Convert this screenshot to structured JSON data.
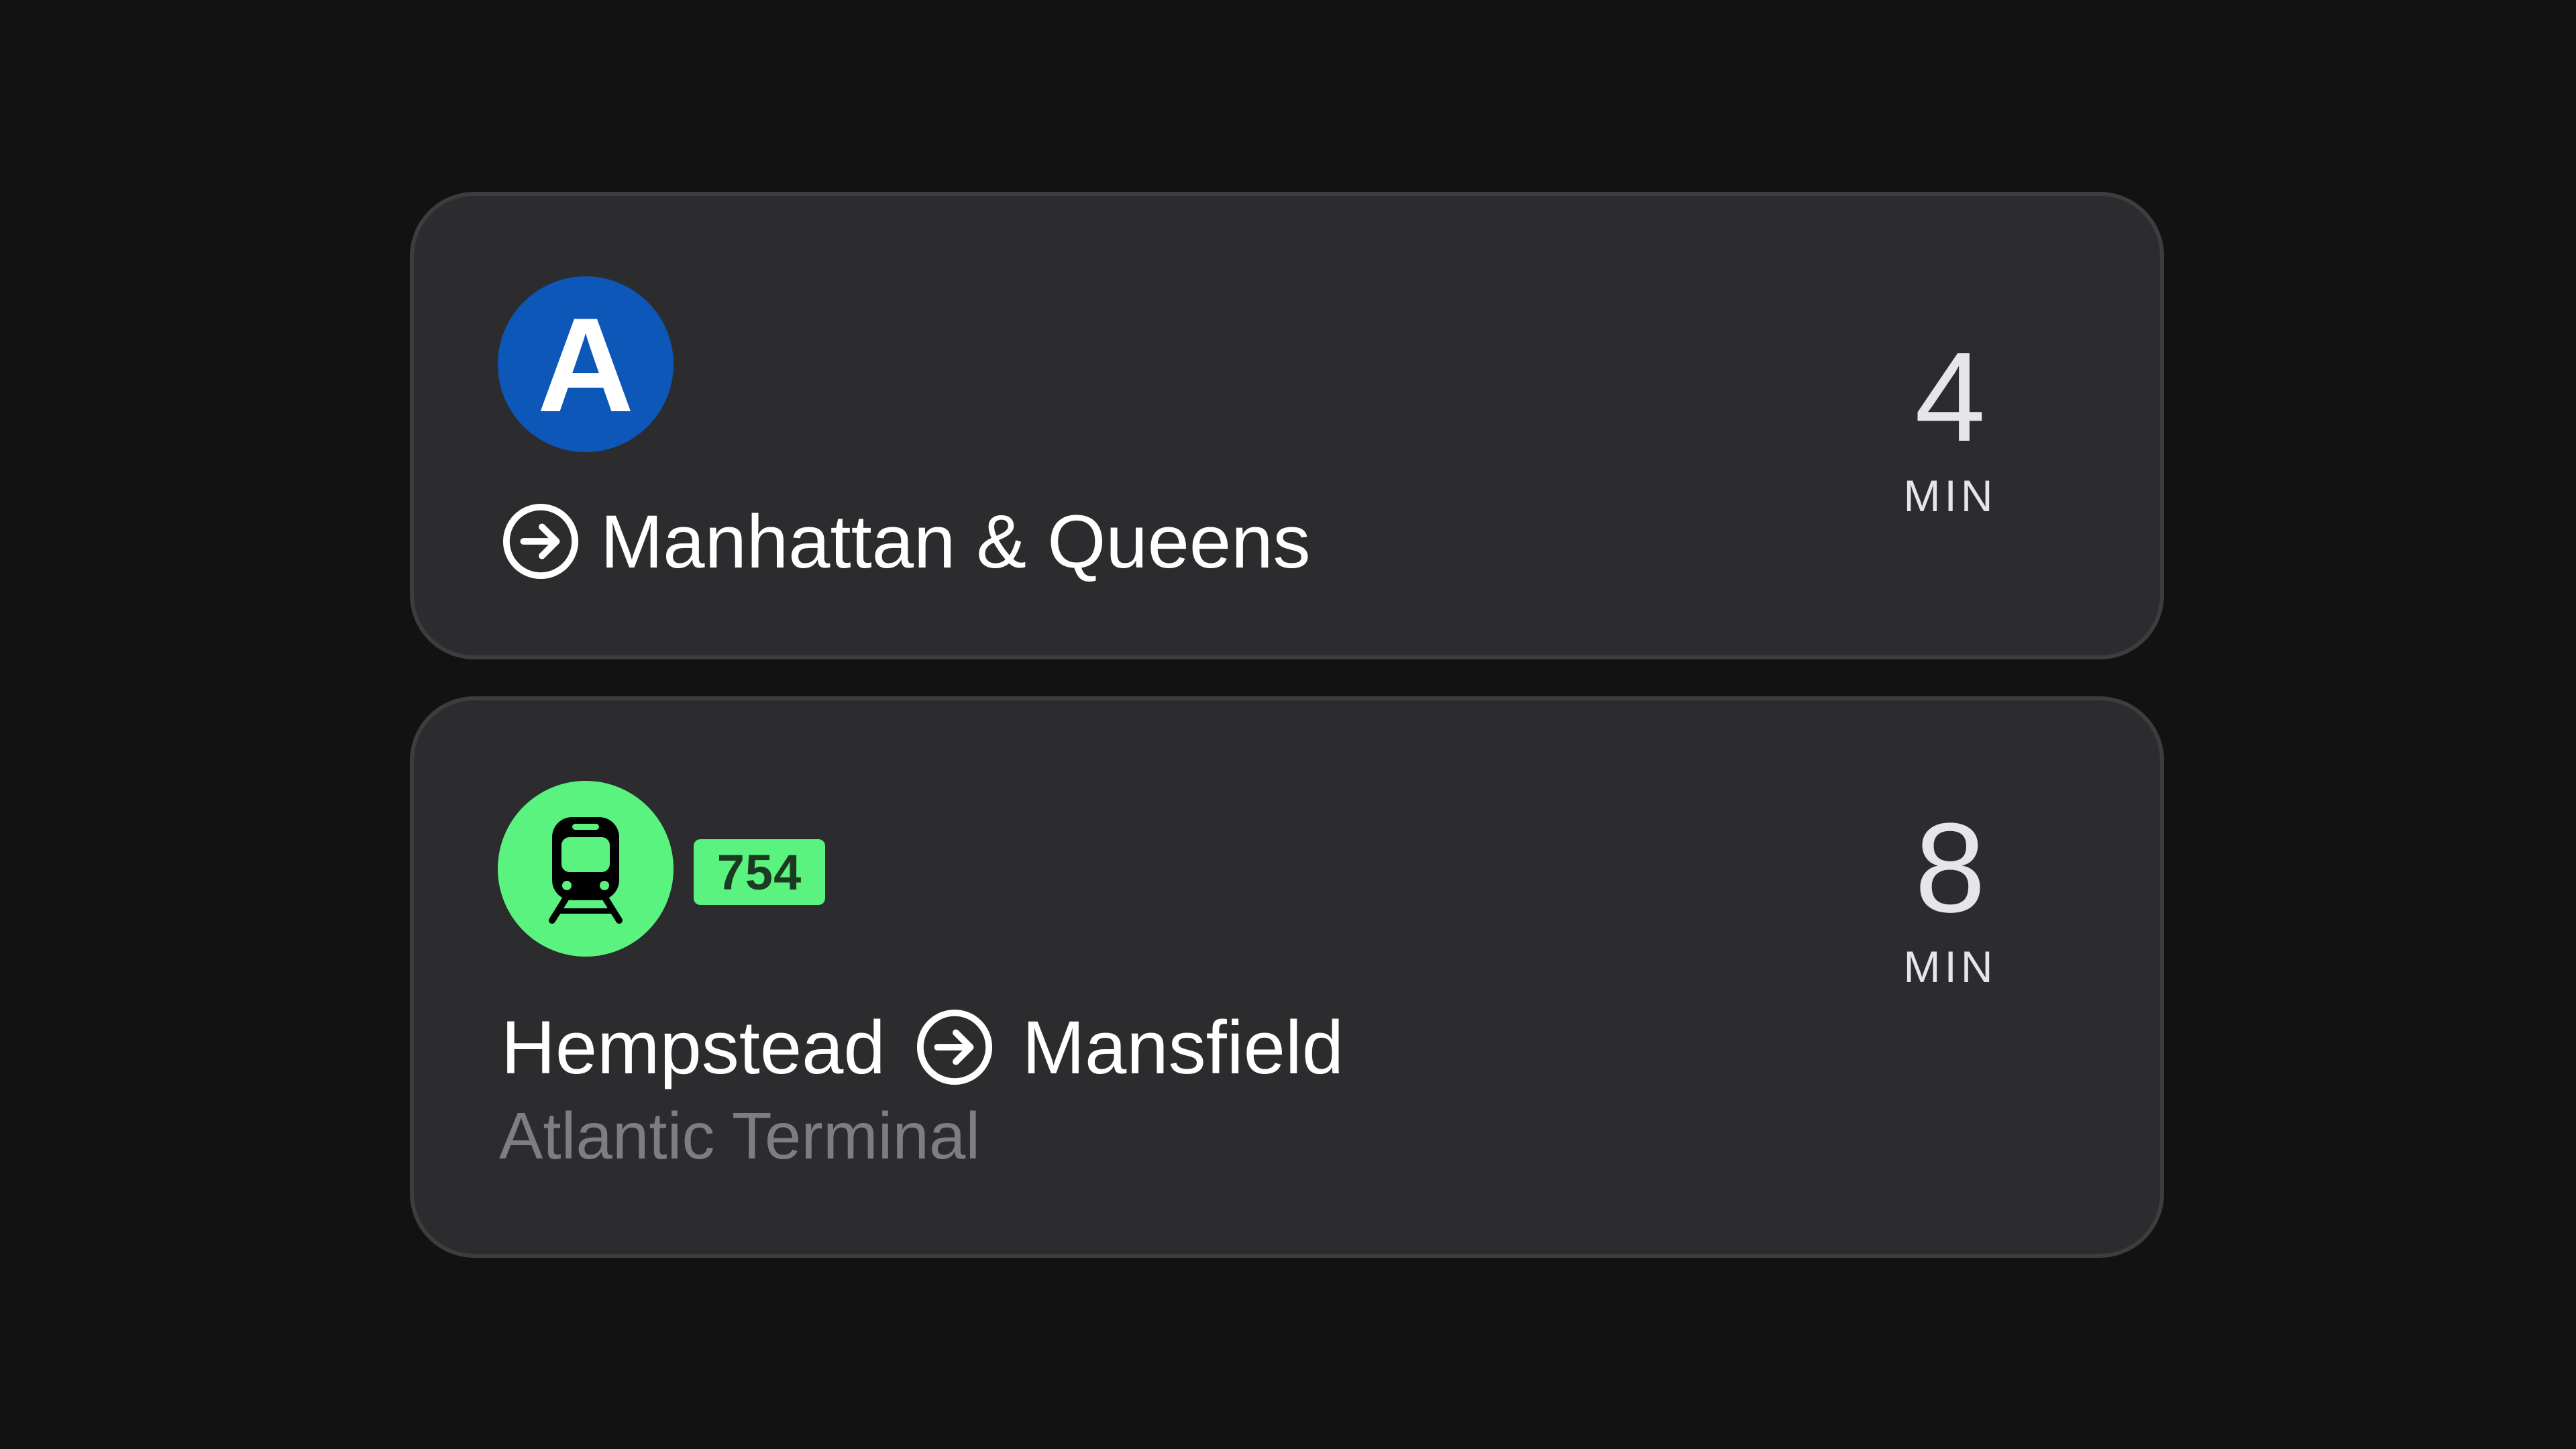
{
  "departures": [
    {
      "route_label": "A",
      "route_color": "#0c57b8",
      "destination": "Manhattan & Queens",
      "eta_minutes": "4",
      "eta_unit": "MIN"
    },
    {
      "route_icon": "train-icon",
      "route_color": "#5bf37f",
      "route_number": "754",
      "origin": "Hempstead",
      "destination": "Mansfield",
      "via": "Atlantic Terminal",
      "eta_minutes": "8",
      "eta_unit": "MIN"
    }
  ]
}
